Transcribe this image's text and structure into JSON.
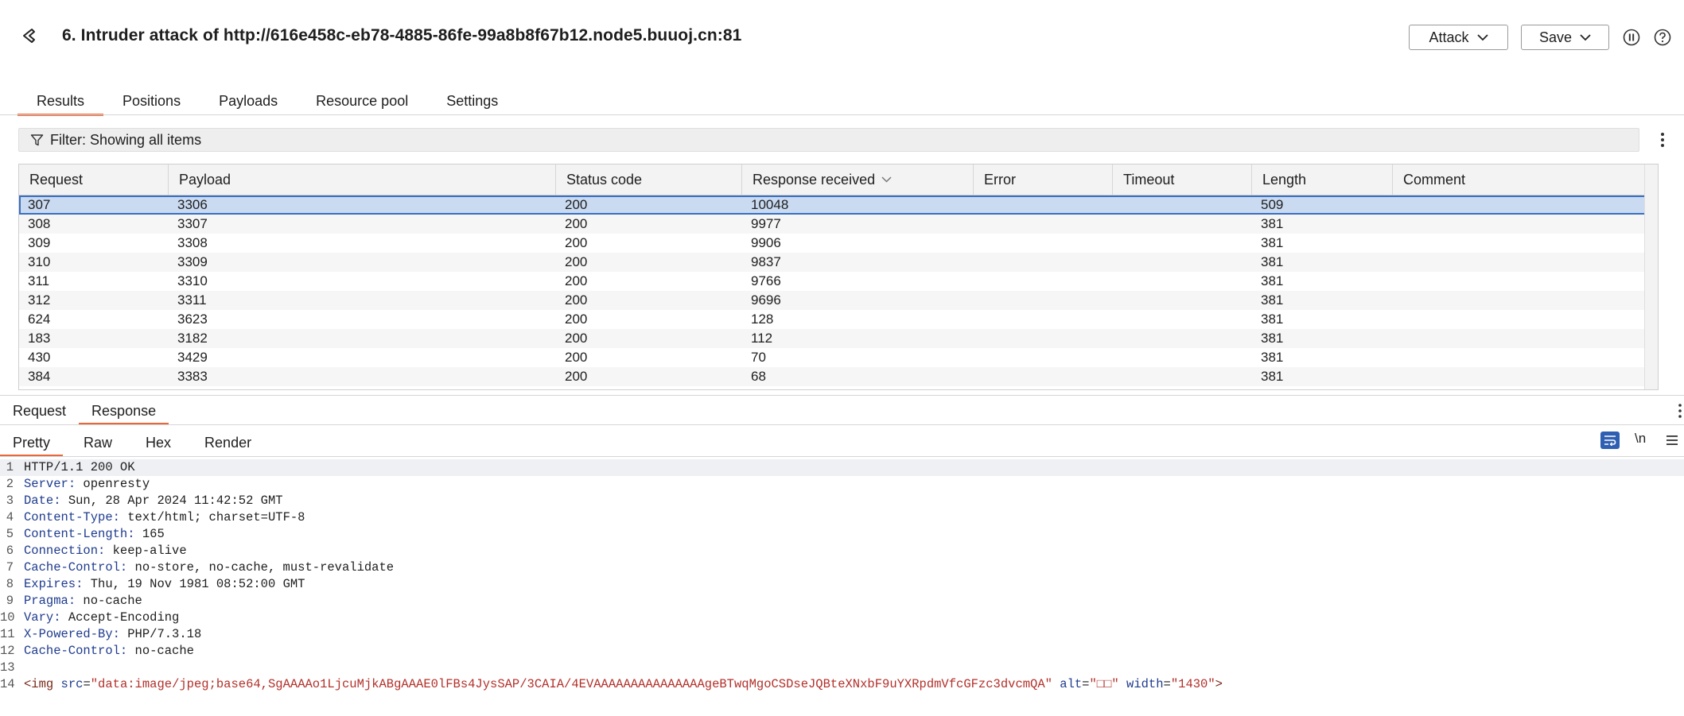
{
  "window": {
    "title": "6. Intruder attack of http://616e458c-eb78-4885-86fe-99a8b8f67b12.node5.buuoj.cn:81",
    "attack_label": "Attack",
    "save_label": "Save",
    "icons": [
      "back-icon",
      "chevron-down-icon",
      "pause-icon",
      "help-icon"
    ]
  },
  "tabs": [
    "Results",
    "Positions",
    "Payloads",
    "Resource pool",
    "Settings"
  ],
  "filter": {
    "label": "Filter: Showing all items"
  },
  "table": {
    "columns": [
      "Request",
      "Payload",
      "Status code",
      "Response received",
      "Error",
      "Timeout",
      "Length",
      "Comment"
    ],
    "rows": [
      {
        "request": "307",
        "payload": "3306",
        "status": "200",
        "response_received": "10048",
        "error": "",
        "timeout": "",
        "length": "509",
        "comment": ""
      },
      {
        "request": "308",
        "payload": "3307",
        "status": "200",
        "response_received": "9977",
        "error": "",
        "timeout": "",
        "length": "381",
        "comment": ""
      },
      {
        "request": "309",
        "payload": "3308",
        "status": "200",
        "response_received": "9906",
        "error": "",
        "timeout": "",
        "length": "381",
        "comment": ""
      },
      {
        "request": "310",
        "payload": "3309",
        "status": "200",
        "response_received": "9837",
        "error": "",
        "timeout": "",
        "length": "381",
        "comment": ""
      },
      {
        "request": "311",
        "payload": "3310",
        "status": "200",
        "response_received": "9766",
        "error": "",
        "timeout": "",
        "length": "381",
        "comment": ""
      },
      {
        "request": "312",
        "payload": "3311",
        "status": "200",
        "response_received": "9696",
        "error": "",
        "timeout": "",
        "length": "381",
        "comment": ""
      },
      {
        "request": "624",
        "payload": "3623",
        "status": "200",
        "response_received": "128",
        "error": "",
        "timeout": "",
        "length": "381",
        "comment": ""
      },
      {
        "request": "183",
        "payload": "3182",
        "status": "200",
        "response_received": "112",
        "error": "",
        "timeout": "",
        "length": "381",
        "comment": ""
      },
      {
        "request": "430",
        "payload": "3429",
        "status": "200",
        "response_received": "70",
        "error": "",
        "timeout": "",
        "length": "381",
        "comment": ""
      },
      {
        "request": "384",
        "payload": "3383",
        "status": "200",
        "response_received": "68",
        "error": "",
        "timeout": "",
        "length": "381",
        "comment": ""
      }
    ]
  },
  "message_tabs": [
    "Request",
    "Response"
  ],
  "view_tabs": [
    "Pretty",
    "Raw",
    "Hex",
    "Render"
  ],
  "newline_label": "\\n",
  "response": {
    "status_line": "HTTP/1.1 200 OK",
    "headers": [
      {
        "name": "Server",
        "value": "openresty"
      },
      {
        "name": "Date",
        "value": "Sun, 28 Apr 2024 11:42:52 GMT"
      },
      {
        "name": "Content-Type",
        "value": "text/html; charset=UTF-8"
      },
      {
        "name": "Content-Length",
        "value": "165"
      },
      {
        "name": "Connection",
        "value": "keep-alive"
      },
      {
        "name": "Cache-Control",
        "value": "no-store, no-cache, must-revalidate"
      },
      {
        "name": "Expires",
        "value": "Thu, 19 Nov 1981 08:52:00 GMT"
      },
      {
        "name": "Pragma",
        "value": "no-cache"
      },
      {
        "name": "Vary",
        "value": "Accept-Encoding"
      },
      {
        "name": "X-Powered-By",
        "value": "PHP/7.3.18"
      },
      {
        "name": "Cache-Control",
        "value": "no-cache"
      }
    ],
    "body": {
      "tag_open": "<img",
      "src_attr": "src",
      "src_value": "\"data:image/jpeg;base64,SgAAAAo1LjcuMjkABgAAAE0lFBs4JysSAP/3CAIA/4EVAAAAAAAAAAAAAAAgeBTwqMgoCSDseJQBteXNxbF9uYXRpdmVfcGFzc3dvcmQA\"",
      "alt_attr": "alt",
      "alt_value": "\"□□\"",
      "width_attr": "width",
      "width_value": "\"1430\"",
      "tag_close": ">"
    },
    "line_numbers": [
      "1",
      "2",
      "3",
      "4",
      "5",
      "6",
      "7",
      "8",
      "9",
      "10",
      "11",
      "12",
      "13",
      "14"
    ]
  }
}
